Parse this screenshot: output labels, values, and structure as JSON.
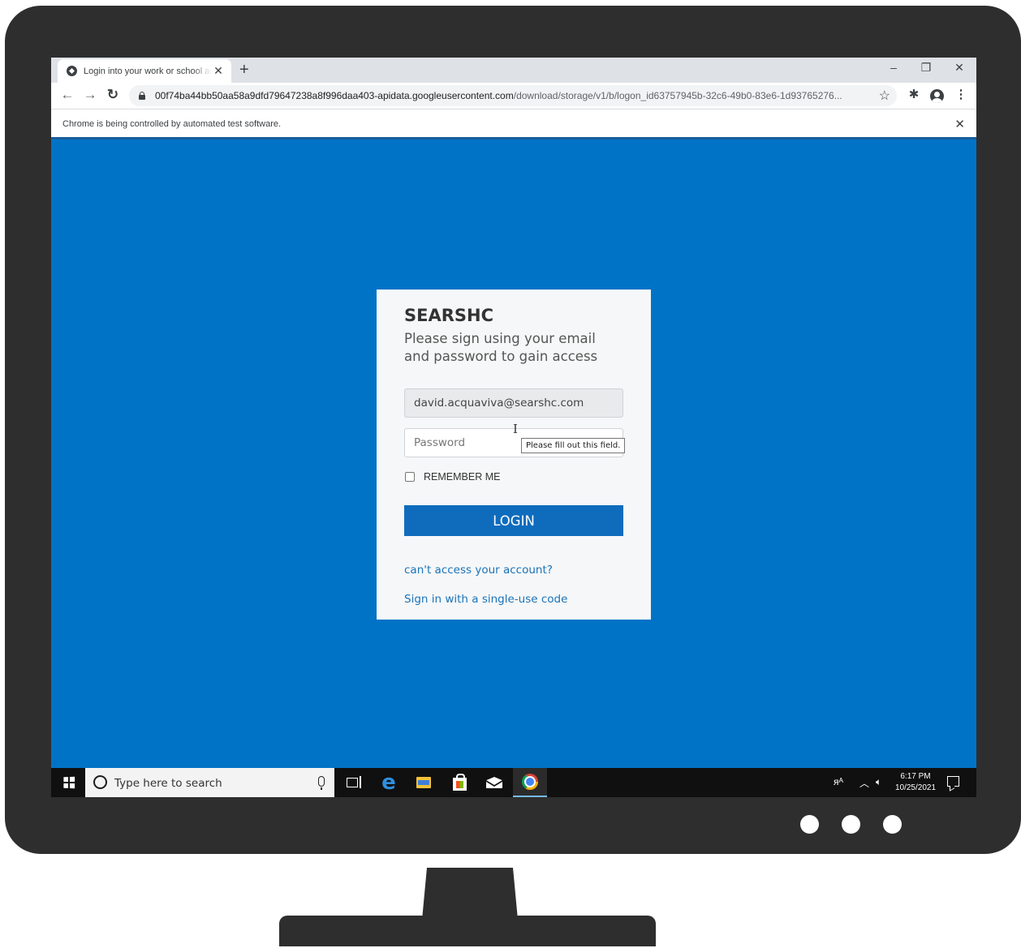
{
  "browser": {
    "tab_title": "Login into your work or school account",
    "tab_close": "✕",
    "new_tab": "+",
    "minimize": "–",
    "restore": "❐",
    "close": "✕",
    "url_host": "00f74ba44bb50aa58a9dfd79647238a8f996daa403-apidata.googleusercontent.com",
    "url_path": "/download/storage/v1/b/logon_id63757945b-32c6-49b0-83e6-1d93765276...",
    "infobar_text": "Chrome is being controlled by automated test software.",
    "infobar_close": "✕"
  },
  "login": {
    "brand": "SEARSHC",
    "subtitle": "Please sign using your email and password to gain access",
    "email_value": "david.acquaviva@searshc.com",
    "password_placeholder": "Password",
    "tooltip": "Please fill out this field.",
    "remember_label": "REMEMBER ME",
    "remember_checked": false,
    "login_button": "LOGIN",
    "link_cant_access": "can't access your account?",
    "link_single_use": "Sign in with a single-use code"
  },
  "taskbar": {
    "search_placeholder": "Type here to search",
    "time": "6:17 PM",
    "date": "10/25/2021",
    "active_app": "chrome"
  },
  "colors": {
    "desktop_blue": "#0173c7",
    "button_blue": "#0f6cbd",
    "link_blue": "#1a73b8",
    "monitor_frame": "#2e2e2e"
  }
}
